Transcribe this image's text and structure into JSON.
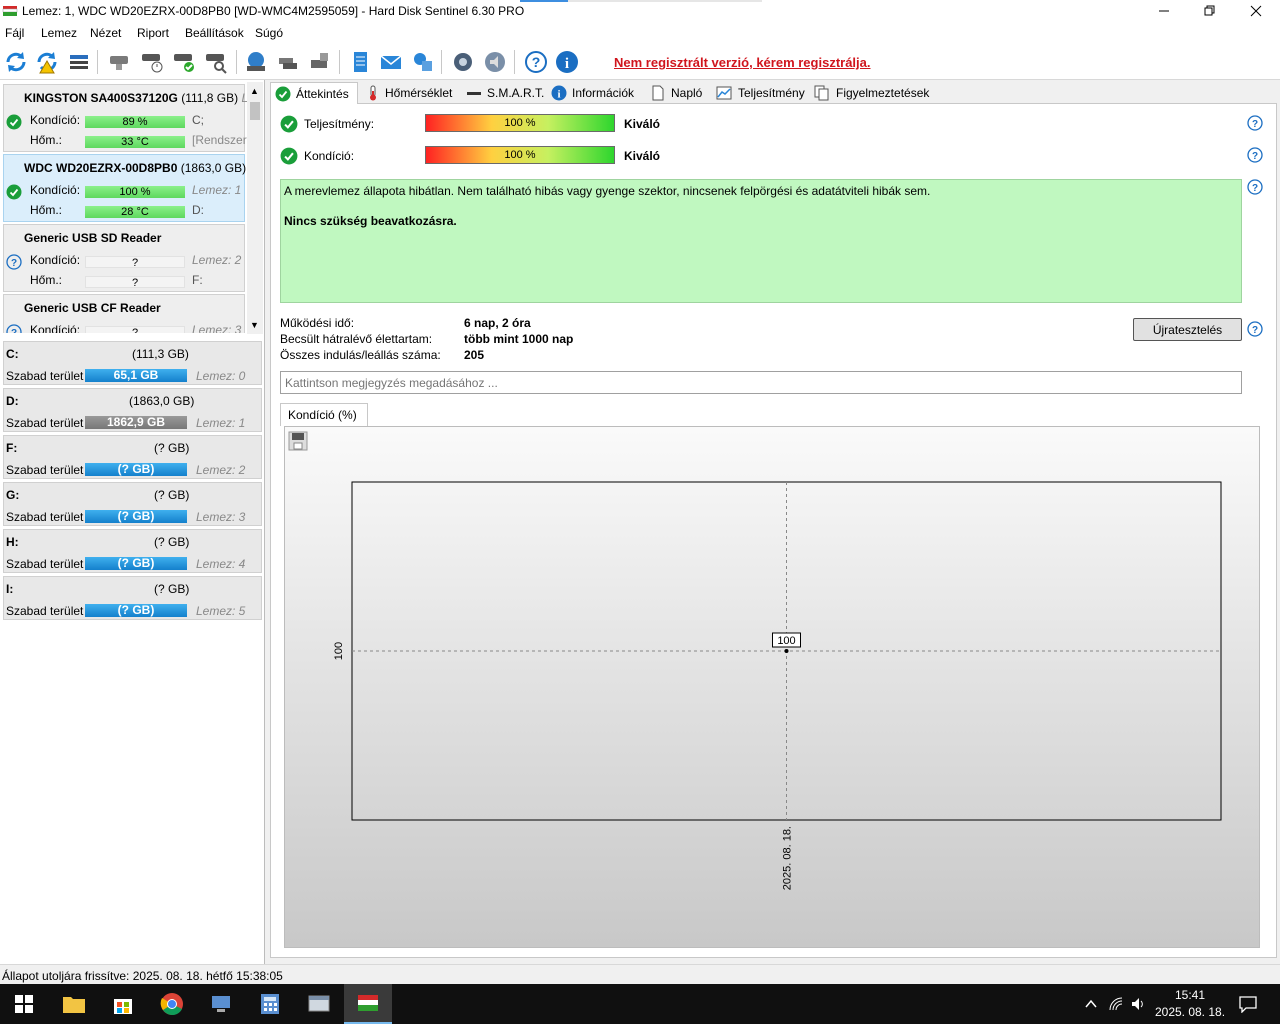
{
  "window": {
    "title": "Lemez: 1, WDC WD20EZRX-00D8PB0 [WD-WMC4M2595059]  -  Hard Disk Sentinel 6.30 PRO"
  },
  "menu": [
    "Fájl",
    "Lemez",
    "Nézet",
    "Riport",
    "Beállítások",
    "Súgó"
  ],
  "toolbar": {
    "unregistered": "Nem regisztrált verzió, kérem regisztrálja."
  },
  "disks": [
    {
      "name": "KINGSTON SA400S37120G",
      "size": "(111,8 GB)",
      "extra": "L",
      "condition_label": "Kondíció:",
      "condition": "89 %",
      "temp_label": "Hőm.:",
      "temp": "33 °C",
      "r1": "C;",
      "r2": "[Rendszer"
    },
    {
      "name": "WDC WD20EZRX-00D8PB0",
      "size": "(1863,0 GB)",
      "condition_label": "Kondíció:",
      "condition": "100 %",
      "temp_label": "Hőm.:",
      "temp": "28 °C",
      "r1": "Lemez: 1",
      "r2": "D:"
    },
    {
      "name": "Generic USB SD Reader",
      "condition_label": "Kondíció:",
      "condition": "?",
      "temp_label": "Hőm.:",
      "temp": "?",
      "r1": "Lemez: 2",
      "r2": "F:"
    },
    {
      "name": "Generic USB CF Reader",
      "condition_label": "Kondíció:",
      "condition": "?",
      "r1": "Lemez: 3"
    }
  ],
  "volumes": [
    {
      "name": "C:",
      "size": "(111,3 GB)",
      "label": "Szabad terület",
      "free": "65,1 GB",
      "disk": "Lemez: 0"
    },
    {
      "name": "D:",
      "size": "(1863,0 GB)",
      "label": "Szabad terület",
      "free": "1862,9 GB",
      "disk": "Lemez: 1"
    },
    {
      "name": "F:",
      "size": "(? GB)",
      "label": "Szabad terület",
      "free": "(? GB)",
      "disk": "Lemez: 2"
    },
    {
      "name": "G:",
      "size": "(? GB)",
      "label": "Szabad terület",
      "free": "(? GB)",
      "disk": "Lemez: 3"
    },
    {
      "name": "H:",
      "size": "(? GB)",
      "label": "Szabad terület",
      "free": "(? GB)",
      "disk": "Lemez: 4"
    },
    {
      "name": "I:",
      "size": "(? GB)",
      "label": "Szabad terület",
      "free": "(? GB)",
      "disk": "Lemez: 5"
    }
  ],
  "tabs": [
    "Áttekintés",
    "Hőmérséklet",
    "S.M.A.R.T.",
    "Információk",
    "Napló",
    "Teljesítmény",
    "Figyelmeztetések"
  ],
  "overview": {
    "performance_label": "Teljesítmény:",
    "performance_value": "100 %",
    "performance_rating": "Kiváló",
    "condition_label": "Kondíció:",
    "condition_value": "100 %",
    "condition_rating": "Kiváló",
    "status_text": "A merevlemez állapota hibátlan. Nem található hibás vagy gyenge szektor, nincsenek felpörgési és adatátviteli hibák sem.",
    "status_action": "Nincs szükség beavatkozásra.",
    "uptime_label": "Működési idő:",
    "uptime_value": "6 nap, 2 óra",
    "life_label": "Becsült hátralévő élettartam:",
    "life_value": "több mint 1000 nap",
    "starts_label": "Összes indulás/leállás száma:",
    "starts_value": "205",
    "retest_button": "Újratesztelés",
    "note_placeholder": "Kattintson megjegyzés megadásához ..."
  },
  "chart_tab": "Kondíció  (%)",
  "chart_data": {
    "type": "line",
    "title": "",
    "xlabel": "",
    "ylabel": "",
    "x": [
      "2025. 08. 18."
    ],
    "series": [
      {
        "values": [
          100
        ]
      }
    ],
    "point_label": "100",
    "ytick": "100",
    "grid": true
  },
  "statusbar": "Állapot utoljára frissítve: 2025. 08. 18. hétfő 15:38:05",
  "taskbar": {
    "time": "15:41",
    "date": "2025. 08. 18."
  }
}
